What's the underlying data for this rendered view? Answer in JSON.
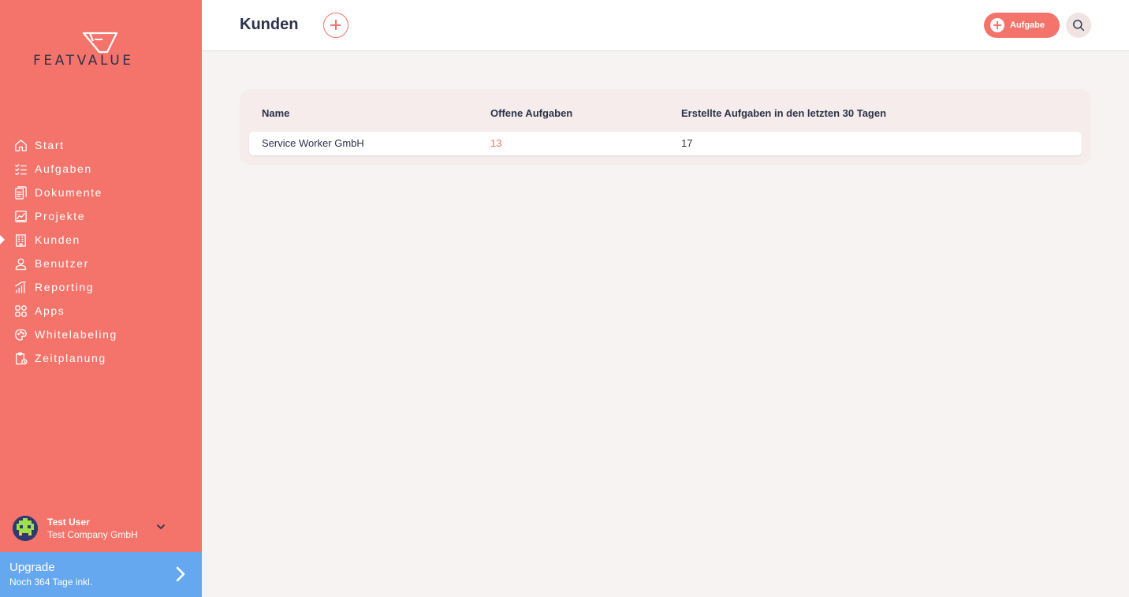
{
  "brand": {
    "name": "FEATVALUE"
  },
  "nav": [
    {
      "label": "Start",
      "icon": "home-icon"
    },
    {
      "label": "Aufgaben",
      "icon": "checklist-icon"
    },
    {
      "label": "Dokumente",
      "icon": "document-icon"
    },
    {
      "label": "Projekte",
      "icon": "chart-icon"
    },
    {
      "label": "Kunden",
      "icon": "building-icon",
      "active": true
    },
    {
      "label": "Benutzer",
      "icon": "user-icon"
    },
    {
      "label": "Reporting",
      "icon": "bars-icon"
    },
    {
      "label": "Apps",
      "icon": "apps-icon"
    },
    {
      "label": "Whitelabeling",
      "icon": "palette-icon"
    },
    {
      "label": "Zeitplanung",
      "icon": "clipboard-clock-icon"
    }
  ],
  "user": {
    "name": "Test User",
    "company": "Test Company GmbH"
  },
  "upgrade": {
    "title": "Upgrade",
    "subtitle": "Noch 364 Tage inkl."
  },
  "header": {
    "title": "Kunden",
    "task_button": "Aufgabe"
  },
  "table": {
    "columns": [
      "Name",
      "Offene Aufgaben",
      "Erstellte Aufgaben in den letzten 30 Tagen"
    ],
    "rows": [
      {
        "name": "Service Worker GmbH",
        "open": "13",
        "created": "17"
      }
    ]
  },
  "colors": {
    "accent": "#f4736a",
    "upgrade": "#66a8f0",
    "text": "#2c3349"
  }
}
